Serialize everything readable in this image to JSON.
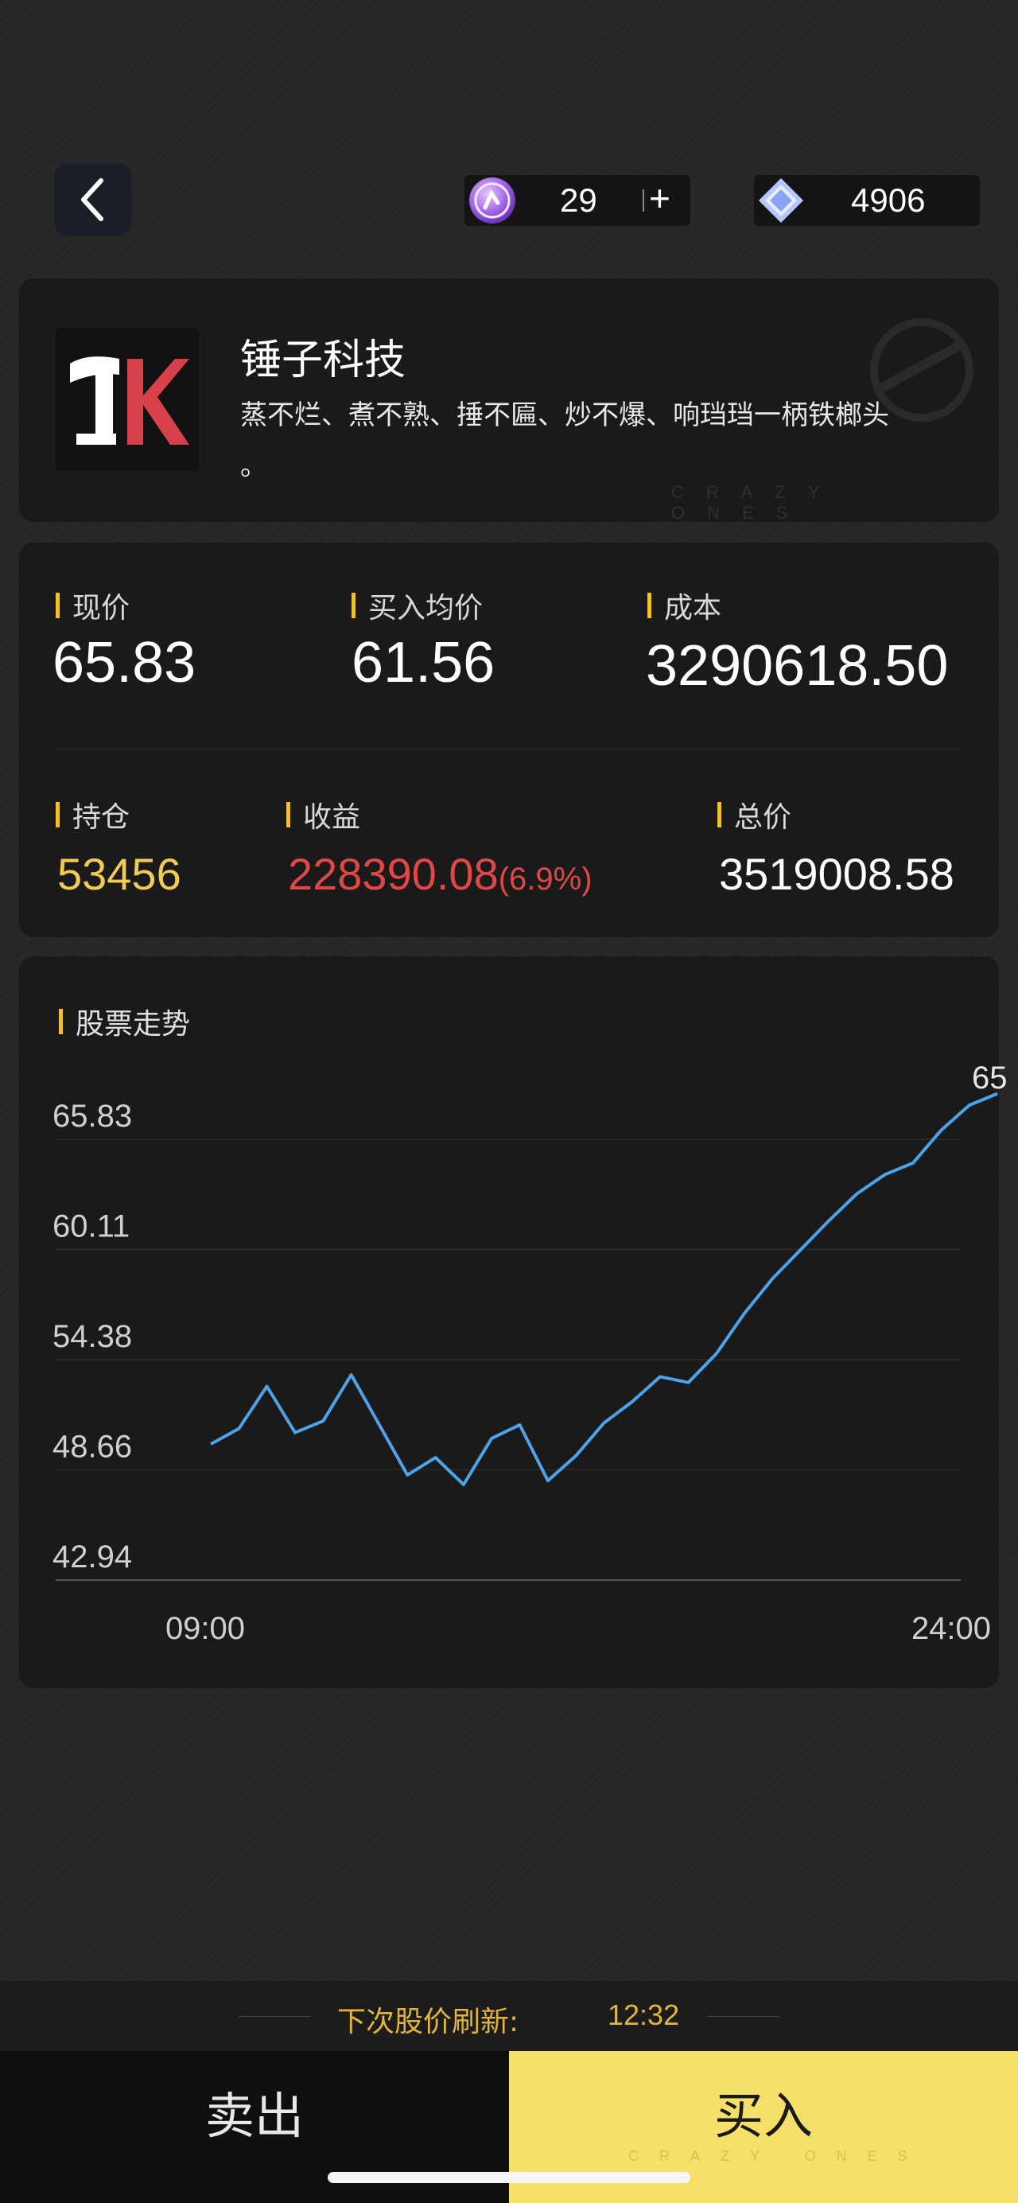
{
  "header": {
    "back_icon": "chevron-left-icon",
    "currency1": {
      "icon": "purple-coin-icon",
      "value": "29",
      "add_label": "+"
    },
    "currency2": {
      "icon": "diamond-icon",
      "value": "4906"
    }
  },
  "stock": {
    "logo_icon": "hammer-tk-logo",
    "name": "锤子科技",
    "description": "蒸不烂、煮不熟、捶不匾、炒不爆、响珰珰一柄铁榔头",
    "description_end": "。",
    "watermark": "CRAZY ONES"
  },
  "stats": {
    "current_price": {
      "label": "现价",
      "value": "65.83"
    },
    "avg_buy_price": {
      "label": "买入均价",
      "value": "61.56"
    },
    "cost": {
      "label": "成本",
      "value": "3290618.50"
    },
    "holding": {
      "label": "持仓",
      "value": "53456"
    },
    "profit": {
      "label": "收益",
      "value": "228390.08",
      "pct": "(6.9%)"
    },
    "total": {
      "label": "总价",
      "value": "3519008.58"
    }
  },
  "chart_data": {
    "type": "line",
    "title": "股票走势",
    "y_ticks": [
      "65.83",
      "60.11",
      "54.38",
      "48.66",
      "42.94"
    ],
    "ylim": [
      42.94,
      65.83
    ],
    "x_ticks": [
      "09:00",
      "24:00"
    ],
    "end_label": "65",
    "grid": true,
    "series": [
      {
        "color": "#4da3ea",
        "values": [
          50.0,
          50.8,
          53.0,
          50.6,
          51.2,
          53.6,
          51.0,
          48.4,
          49.3,
          47.9,
          50.3,
          51.0,
          48.1,
          49.4,
          51.1,
          52.2,
          53.5,
          53.2,
          54.7,
          56.8,
          58.6,
          60.1,
          61.6,
          63.0,
          64.0,
          64.6,
          66.3,
          67.6,
          68.2
        ]
      }
    ]
  },
  "footer": {
    "refresh_label": "下次股价刷新:",
    "refresh_time": "12:32",
    "sell_label": "卖出",
    "buy_label": "买入",
    "watermark": "CRAZY ONES"
  },
  "colors": {
    "accent": "#f0c030",
    "loss_red": "#e04848",
    "holding_yellow": "#f2cb55",
    "buy_bg": "#f7e06a",
    "line_blue": "#4da3ea"
  }
}
